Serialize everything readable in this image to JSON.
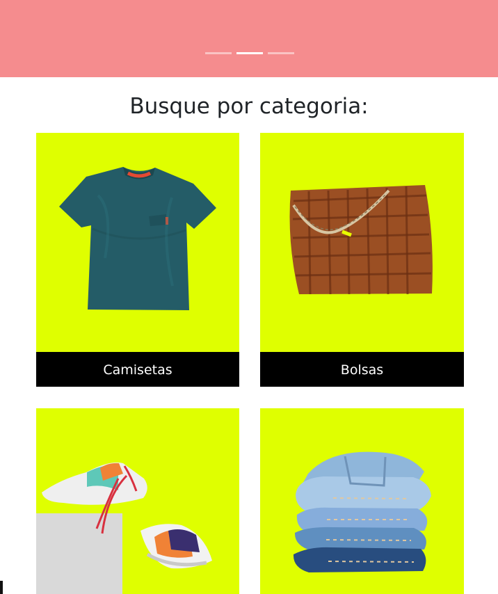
{
  "hero": {
    "indicators": [
      {
        "label": "",
        "active": false
      },
      {
        "label": "",
        "active": true
      },
      {
        "label": "",
        "active": false
      }
    ]
  },
  "section": {
    "title": "Busque por categoria:"
  },
  "categories": [
    {
      "label": "Camisetas",
      "image_icon": "t-shirt-image"
    },
    {
      "label": "Bolsas",
      "image_icon": "handbag-image"
    },
    {
      "label": "",
      "image_icon": "sneakers-image"
    },
    {
      "label": "",
      "image_icon": "jeans-stack-image"
    }
  ],
  "colors": {
    "banner": "#f58c8e",
    "category_background": "#dfff00",
    "caption_background": "#000000",
    "caption_text": "#ffffff",
    "heading_text": "#1f2327"
  }
}
